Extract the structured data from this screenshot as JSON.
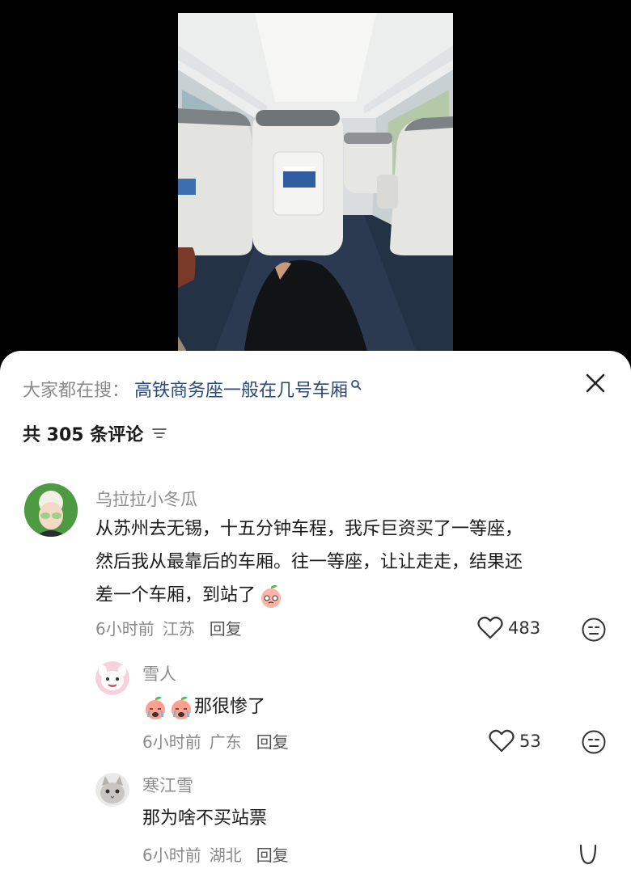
{
  "search": {
    "prefix": "大家都在搜：",
    "query": "高铁商务座一般在几号车厢"
  },
  "comments_header": {
    "count_text": "共 305 条评论"
  },
  "comments": [
    {
      "username": "乌拉拉小冬瓜",
      "text_line1": "从苏州去无锡，十五分钟车程，我斥巨资买了一等座，",
      "text_line2": "然后我从最靠后的车厢。往一等座，让让走走，结果还",
      "text_line3": "差一个车厢，到站了",
      "time": "6小时前",
      "location": "江苏",
      "reply_label": "回复",
      "likes": "483"
    },
    {
      "username": "雪人",
      "text": "那很惨了",
      "time": "6小时前",
      "location": "广东",
      "reply_label": "回复",
      "likes": "53"
    },
    {
      "username": "寒江雪",
      "text": "那为啥不买站票",
      "time": "6小时前",
      "location": "湖北",
      "reply_label": "回复"
    }
  ],
  "icons": {
    "close": "close-icon",
    "sort": "sort-icon",
    "search_hint": "search-icon",
    "like": "heart-icon",
    "dislike": "dislike-face-icon"
  },
  "colors": {
    "query_link": "#2b4a7a",
    "muted_text": "#8a8a8a",
    "sheet_bg": "#ffffff"
  }
}
